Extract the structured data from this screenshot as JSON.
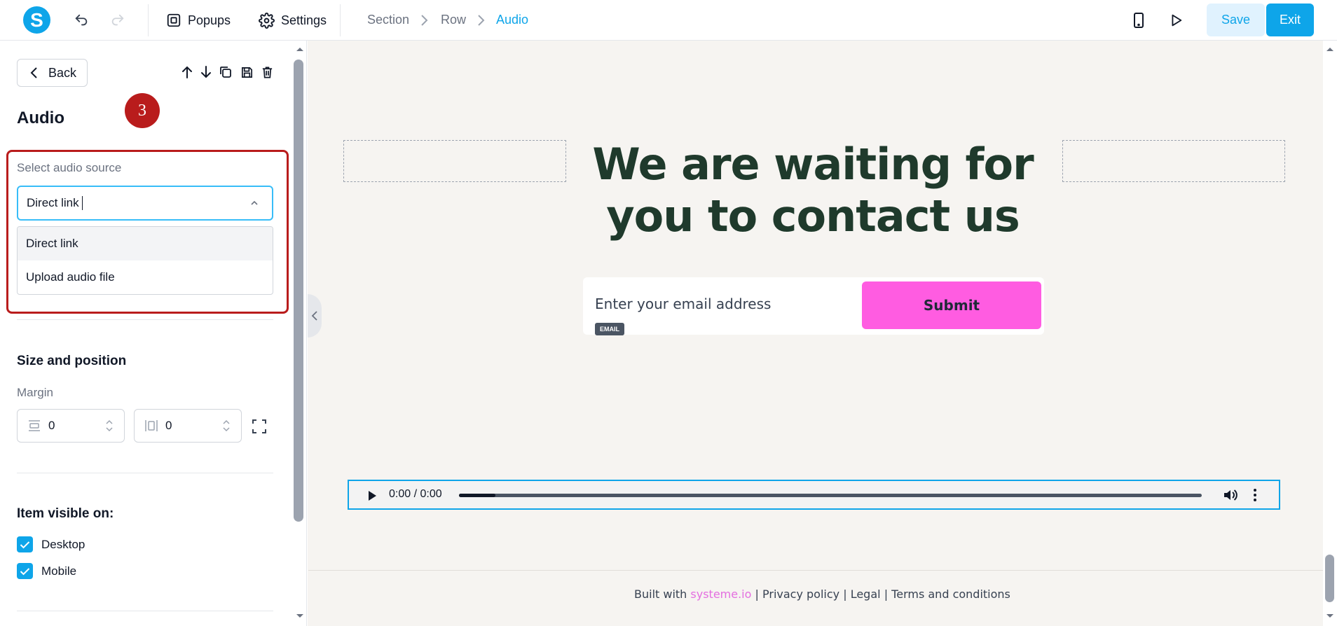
{
  "toolbar": {
    "logo_letter": "S",
    "popups_label": "Popups",
    "settings_label": "Settings",
    "breadcrumb": [
      "Section",
      "Row",
      "Audio"
    ],
    "save_label": "Save",
    "exit_label": "Exit",
    "accent_color": "#0ea5e9"
  },
  "panel": {
    "back_label": "Back",
    "title": "Audio",
    "step_badge": "3",
    "audio_source": {
      "label": "Select audio source",
      "value": "Direct link",
      "options": [
        "Direct link",
        "Upload audio file"
      ]
    },
    "size_position": {
      "title": "Size and position",
      "margin_label": "Margin",
      "margin_vertical": "0",
      "margin_horizontal": "0"
    },
    "visibility": {
      "title": "Item visible on:",
      "desktop_label": "Desktop",
      "desktop_checked": true,
      "mobile_label": "Mobile",
      "mobile_checked": true
    }
  },
  "canvas": {
    "headline_line1": "We are waiting for",
    "headline_line2": "you to contact us",
    "email_placeholder": "Enter your email address",
    "email_tag": "EMAIL",
    "submit_label": "Submit",
    "submit_color": "#ff5ce1",
    "audio_time": "0:00 / 0:00",
    "footer": {
      "built_with": "Built with",
      "brand": "systeme.io",
      "sep": "|",
      "privacy": "Privacy policy",
      "legal": "Legal",
      "terms": "Terms and conditions"
    }
  }
}
